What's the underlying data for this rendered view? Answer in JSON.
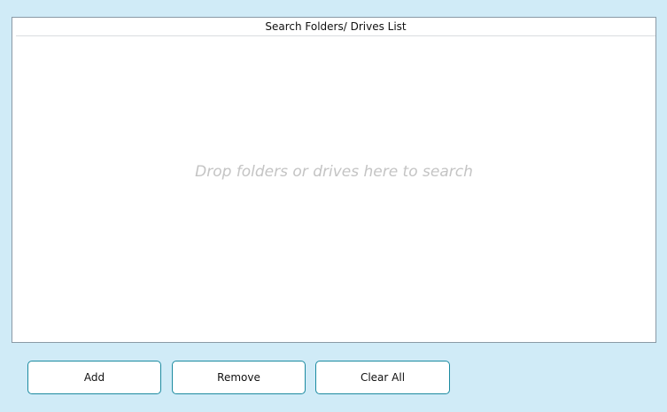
{
  "list": {
    "header": "Search Folders/ Drives List",
    "placeholder": "Drop folders or drives here to search"
  },
  "buttons": {
    "add": "Add",
    "remove": "Remove",
    "clear_all": "Clear All"
  }
}
